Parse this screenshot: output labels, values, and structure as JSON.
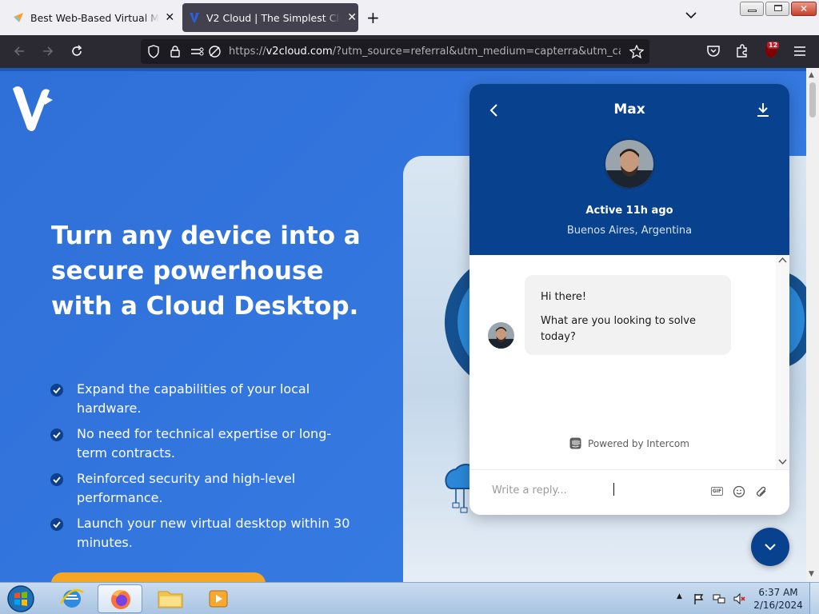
{
  "browser": {
    "tabs": [
      {
        "title": "Best Web-Based Virtual Machin",
        "active": false
      },
      {
        "title": "V2 Cloud | The Simplest Cloud D",
        "active": true
      }
    ],
    "url": {
      "scheme": "https://",
      "host": "v2cloud.com",
      "rest": "/?utm_source=referral&utm_medium=capterra&utm_campa"
    },
    "extension_badge": "12"
  },
  "page": {
    "hero_title": "Turn any device into a secure powerhouse with a Cloud Desktop.",
    "features": [
      "Expand the capabilities of your local hardware.",
      "No need for technical expertise or long-term contracts.",
      "Reinforced security and high-level performance.",
      "Launch your new virtual desktop within 30 minutes."
    ],
    "colors": {
      "brand_blue": "#3478e0",
      "cta_orange": "#f6a623",
      "chat_header": "#08418e"
    }
  },
  "chat": {
    "agent_name": "Max",
    "status": "Active 11h ago",
    "location": "Buenos Aires, Argentina",
    "messages": [
      "Hi there!",
      "What are you looking to solve today?"
    ],
    "powered_by": "Powered by Intercom",
    "reply_placeholder": "Write a reply...",
    "gif_label": "GIF"
  },
  "taskbar": {
    "time": "6:37 AM",
    "date": "2/16/2024"
  }
}
